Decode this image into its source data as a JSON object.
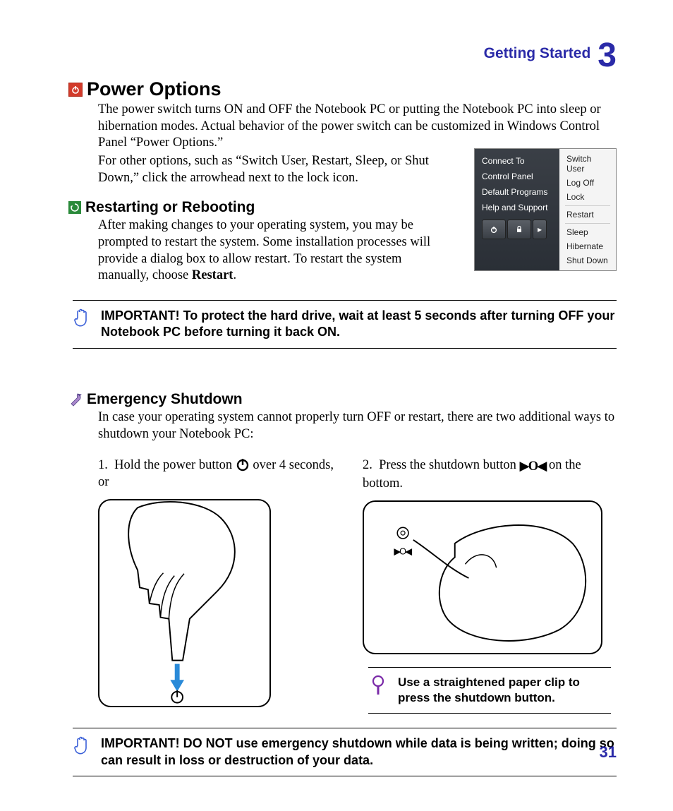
{
  "header": {
    "section": "Getting Started",
    "chapter_number": "3"
  },
  "sections": {
    "power_options": {
      "title": "Power Options",
      "p1": "The power switch turns ON and OFF the Notebook PC or putting the Notebook PC into sleep or hibernation modes. Actual behavior of the power switch can be customized in Windows Control Panel “Power Options.”",
      "p2": "For other options, such as “Switch User, Restart, Sleep, or Shut Down,” click the arrowhead next to the lock icon."
    },
    "restarting": {
      "title": "Restarting or Rebooting",
      "p_before_bold": "After making changes to your operating system, you may be prompted to restart the system. Some installation processes will provide a dialog box to allow restart. To restart the system manually, choose ",
      "bold": "Restart",
      "p_after_bold": "."
    },
    "note1": "IMPORTANT!  To protect the hard drive, wait at least 5 seconds after turning OFF your Notebook PC before turning it back ON.",
    "emergency": {
      "title": "Emergency Shutdown",
      "intro": "In case your operating system cannot properly turn OFF or restart, there are two additional ways to shutdown your Notebook PC:",
      "step1_a": "Hold the power button ",
      "step1_b": " over 4 seconds, or",
      "step1_num": "1.",
      "step2_a": "Press the shutdown button ",
      "step2_b": " on the bottom.",
      "step2_num": "2.",
      "tip": "Use a straightened paper clip to press the shutdown button."
    },
    "note2": "IMPORTANT!  DO NOT use emergency shutdown while data is being written; doing so can result in loss or destruction of your data."
  },
  "start_menu": {
    "left": [
      "Connect To",
      "Control Panel",
      "Default Programs",
      "Help and Support"
    ],
    "right_top": [
      "Switch User",
      "Log Off",
      "Lock"
    ],
    "right_mid": [
      "Restart"
    ],
    "right_bot": [
      "Sleep",
      "Hibernate",
      "Shut Down"
    ]
  },
  "page_number": "31"
}
